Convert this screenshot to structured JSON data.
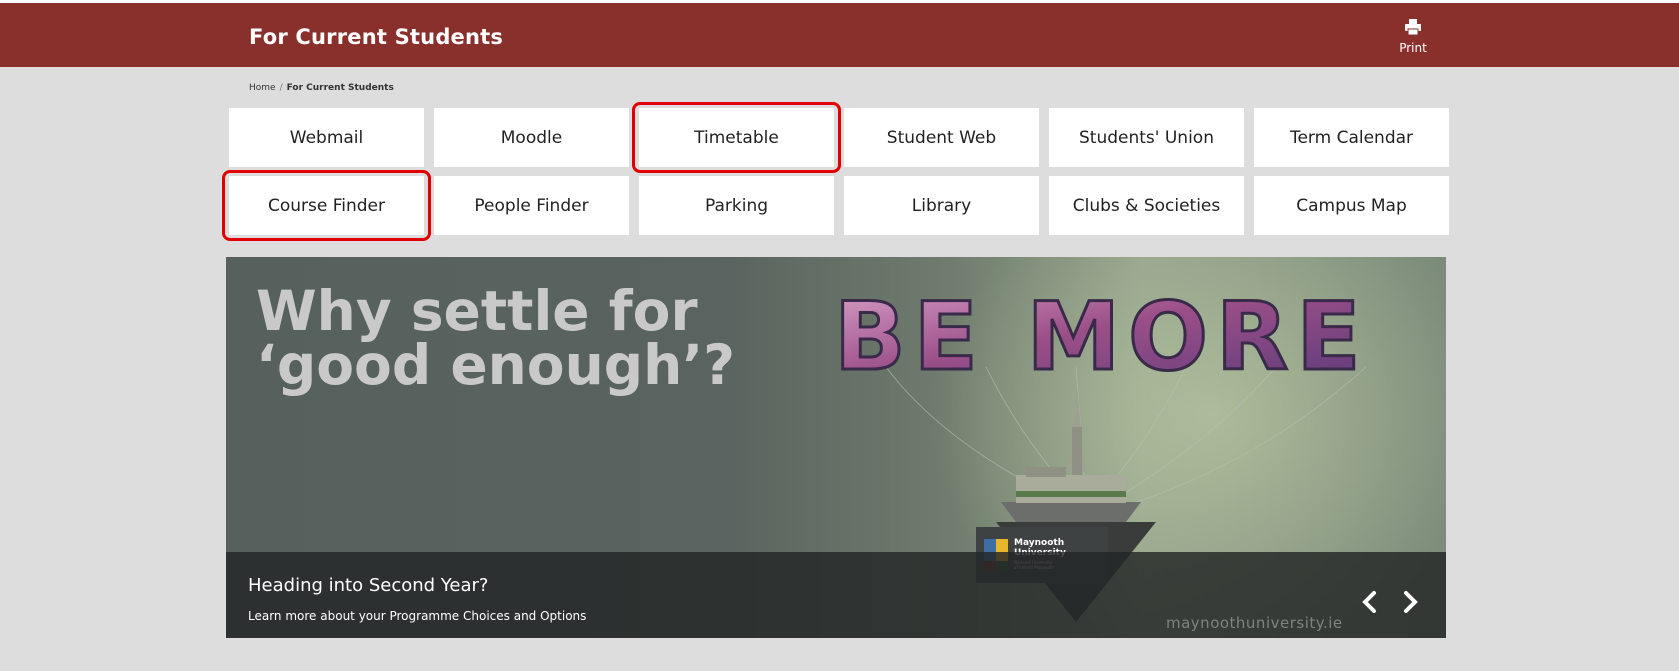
{
  "header": {
    "title": "For Current Students",
    "print_label": "Print",
    "color": "#8a302c"
  },
  "breadcrumb": {
    "home": "Home",
    "separator": "/",
    "current": "For Current Students"
  },
  "quick_links": [
    {
      "label": "Webmail",
      "highlighted": false
    },
    {
      "label": "Moodle",
      "highlighted": false
    },
    {
      "label": "Timetable",
      "highlighted": true
    },
    {
      "label": "Student Web",
      "highlighted": false
    },
    {
      "label": "Students' Union",
      "highlighted": false
    },
    {
      "label": "Term Calendar",
      "highlighted": false
    },
    {
      "label": "Course Finder",
      "highlighted": true
    },
    {
      "label": "People Finder",
      "highlighted": false
    },
    {
      "label": "Parking",
      "highlighted": false
    },
    {
      "label": "Library",
      "highlighted": false
    },
    {
      "label": "Clubs & Societies",
      "highlighted": false
    },
    {
      "label": "Campus Map",
      "highlighted": false
    }
  ],
  "highlight_color": "#e00000",
  "banner": {
    "headline_line1": "Why settle for",
    "headline_line2": "‘good enough’?",
    "campaign_text": "BE MORE",
    "logo_name": "Maynooth",
    "logo_name2": "University",
    "logo_sub1": "National University",
    "logo_sub2": "of Ireland Maynooth",
    "caption_title": "Heading into Second Year?",
    "caption_sub": "Learn more about your Programme Choices and Options",
    "watermark": "maynoothuniversity.ie",
    "prev_icon": "chevron-left-icon",
    "next_icon": "chevron-right-icon"
  }
}
